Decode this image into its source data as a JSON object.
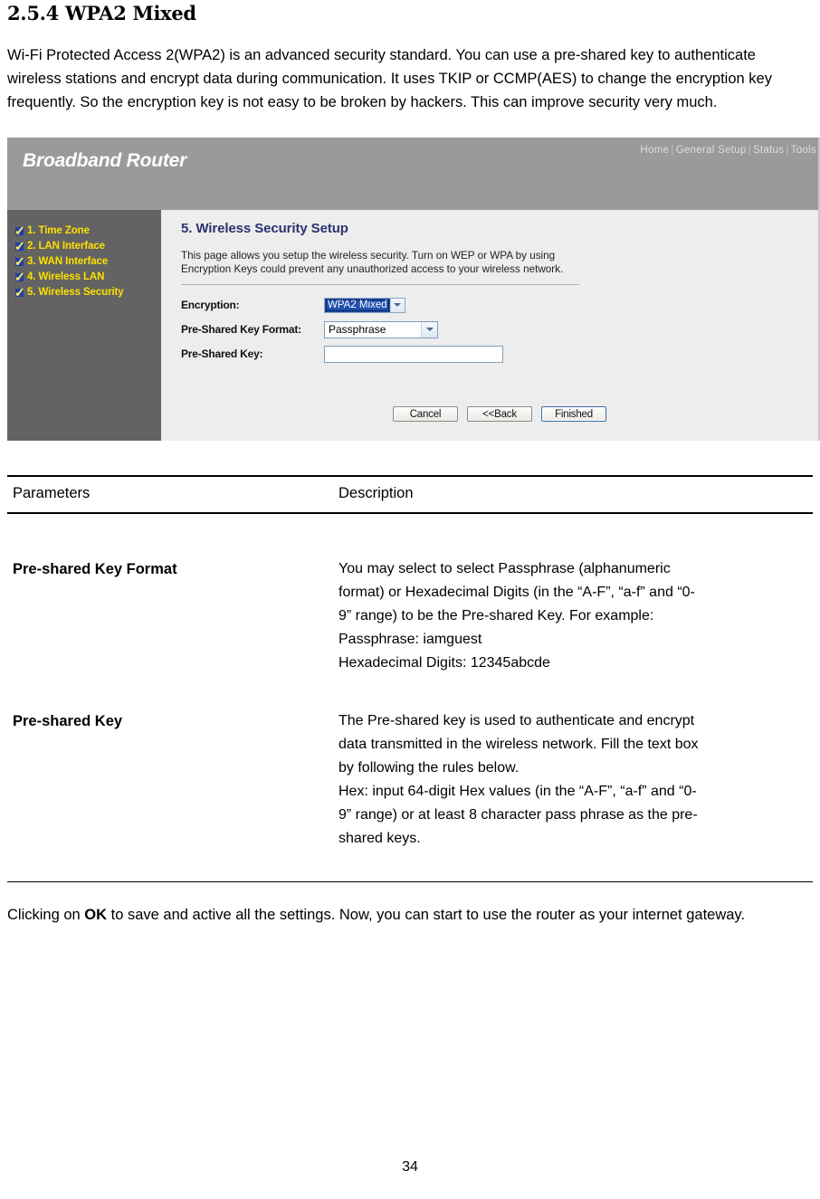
{
  "document": {
    "heading": "2.5.4 WPA2 Mixed",
    "intro_paragraph": "Wi-Fi Protected Access 2(WPA2) is an advanced security standard. You can use a pre-shared key to authenticate wireless stations and encrypt data during communication. It uses TKIP or CCMP(AES) to change the encryption key frequently. So the encryption key is not easy to be broken by hackers. This can improve security very much.",
    "closing_prefix": "Clicking on ",
    "closing_bold": "OK",
    "closing_suffix": " to save and active all the settings. Now, you can start to use the router as your internet gateway.",
    "page_number": "34"
  },
  "router_ui": {
    "brand": "Broadband Router",
    "nav": {
      "home": "Home",
      "general_setup": "General Setup",
      "status": "Status",
      "tools": "Tools",
      "separator": "|"
    },
    "sidebar": {
      "items": [
        {
          "label": "1. Time Zone"
        },
        {
          "label": "2. LAN Interface"
        },
        {
          "label": "3. WAN Interface"
        },
        {
          "label": "4. Wireless LAN"
        },
        {
          "label": "5. Wireless Security"
        }
      ]
    },
    "panel": {
      "title": "5. Wireless Security Setup",
      "description_line1": "This page allows you setup the wireless security. Turn on WEP or WPA by using",
      "description_line2": "Encryption Keys could prevent any unauthorized access to your wireless network."
    },
    "form": {
      "encryption_label": "Encryption:",
      "encryption_value": "WPA2 Mixed",
      "key_format_label": "Pre-Shared Key Format:",
      "key_format_value": "Passphrase",
      "key_label": "Pre-Shared Key:",
      "key_value": "",
      "key_placeholder": ""
    },
    "buttons": {
      "cancel": "Cancel",
      "back": "<<Back",
      "finished": "Finished"
    },
    "colors": {
      "header_gray": "#9a9a9a",
      "sidebar_gray": "#636363",
      "content_gray": "#ededed",
      "sidebar_text_yellow": "#ffe000",
      "panel_title_blue": "#2b3272",
      "select_highlight_blue": "#1f4fb0"
    }
  },
  "param_table": {
    "headers": {
      "parameters": "Parameters",
      "description": "Description"
    },
    "rows": [
      {
        "parameter": "Pre-shared Key Format",
        "description_lines": [
          "You may select to select Passphrase (alphanumeric",
          "format) or Hexadecimal Digits (in the “A-F”, “a-f” and “0-",
          "9” range) to be the Pre-shared Key. For example:",
          "Passphrase: iamguest",
          "Hexadecimal Digits: 12345abcde"
        ]
      },
      {
        "parameter": "Pre-shared Key",
        "description_lines": [
          "The Pre-shared key is used to authenticate and encrypt",
          "data transmitted in the wireless network. Fill the text box",
          "by following the rules below.",
          "Hex: input 64-digit Hex values (in the “A-F”, “a-f” and “0-",
          "9” range) or at least 8 character pass phrase as the pre-",
          "shared keys."
        ]
      }
    ]
  }
}
